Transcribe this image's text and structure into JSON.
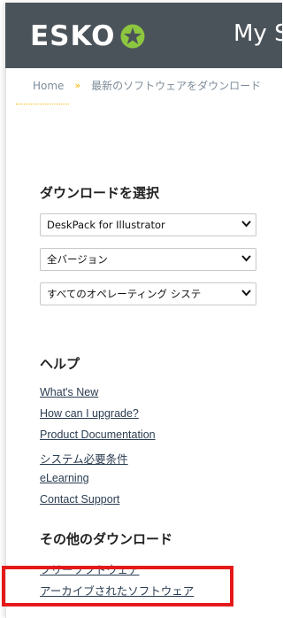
{
  "header": {
    "logo_text": "ESKO",
    "logo_mark": "esko-star-icon",
    "title": "My S",
    "colors": {
      "bar": "#4b535a",
      "accent": "#8dc63f"
    }
  },
  "breadcrumb": {
    "home": "Home",
    "separator": "»",
    "current": "最新のソフトウェアをダウンロード"
  },
  "download_section": {
    "title": "ダウンロードを選択",
    "product_select": "DeskPack for Illustrator",
    "version_select": "全バージョン",
    "os_select": "すべてのオペレーティング システ"
  },
  "help_section": {
    "title": "ヘルプ",
    "links": [
      "What's New",
      "How can I upgrade?",
      "Product Documentation",
      "システム必要条件",
      "eLearning",
      "Contact Support"
    ]
  },
  "other_section": {
    "title": "その他のダウンロード",
    "links": [
      "フリーソフトウェア",
      "アーカイブされたソフトウェア"
    ]
  },
  "annotation": {
    "color": "#e51919"
  }
}
